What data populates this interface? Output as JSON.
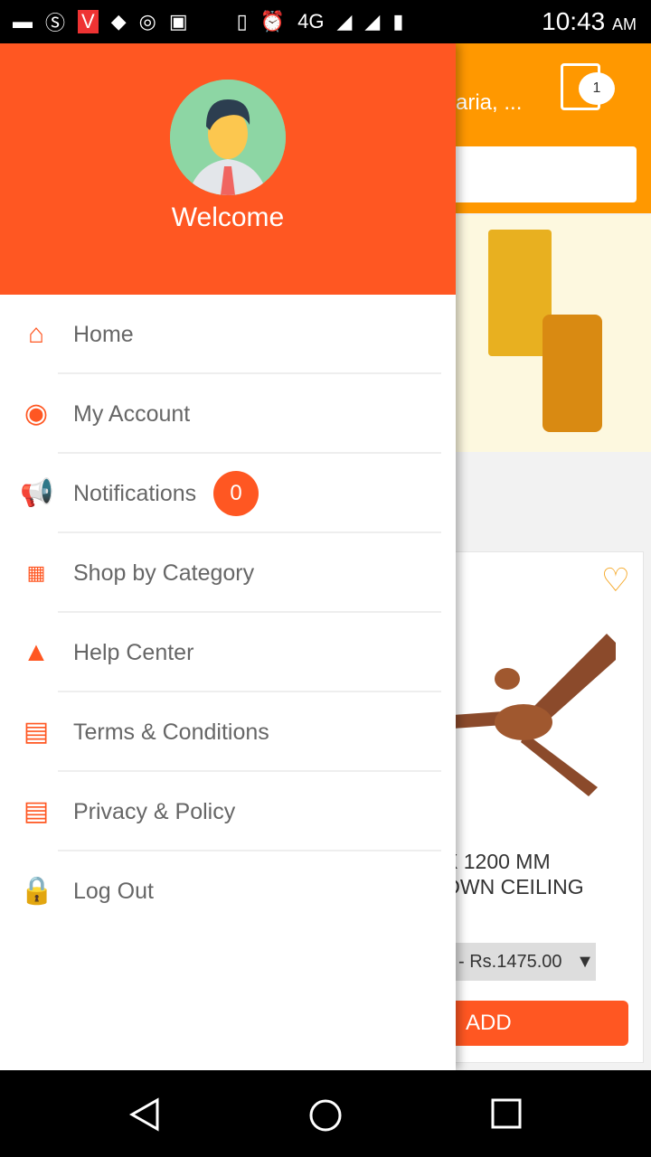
{
  "status_bar": {
    "network": "4G",
    "time": "10:43",
    "ampm": "AM"
  },
  "background": {
    "location": "aria, ...",
    "cart_count": "1",
    "product_title_line1": "X 1200 MM",
    "product_title_line2": "OWN CEILING",
    "price": "- Rs.1475.00",
    "add_label": "ADD"
  },
  "drawer": {
    "welcome": "Welcome",
    "items": [
      {
        "label": "Home",
        "icon": "home-icon"
      },
      {
        "label": "My Account",
        "icon": "account-icon"
      },
      {
        "label": "Notifications",
        "icon": "megaphone-icon",
        "badge": "0"
      },
      {
        "label": "Shop by Category",
        "icon": "grid-icon"
      },
      {
        "label": "Help Center",
        "icon": "navigation-icon"
      },
      {
        "label": "Terms & Conditions",
        "icon": "newspaper-icon"
      },
      {
        "label": "Privacy & Policy",
        "icon": "newspaper-icon"
      },
      {
        "label": "Log Out",
        "icon": "lock-icon"
      }
    ]
  },
  "colors": {
    "accent": "#FF5722",
    "header": "#FF9800"
  }
}
